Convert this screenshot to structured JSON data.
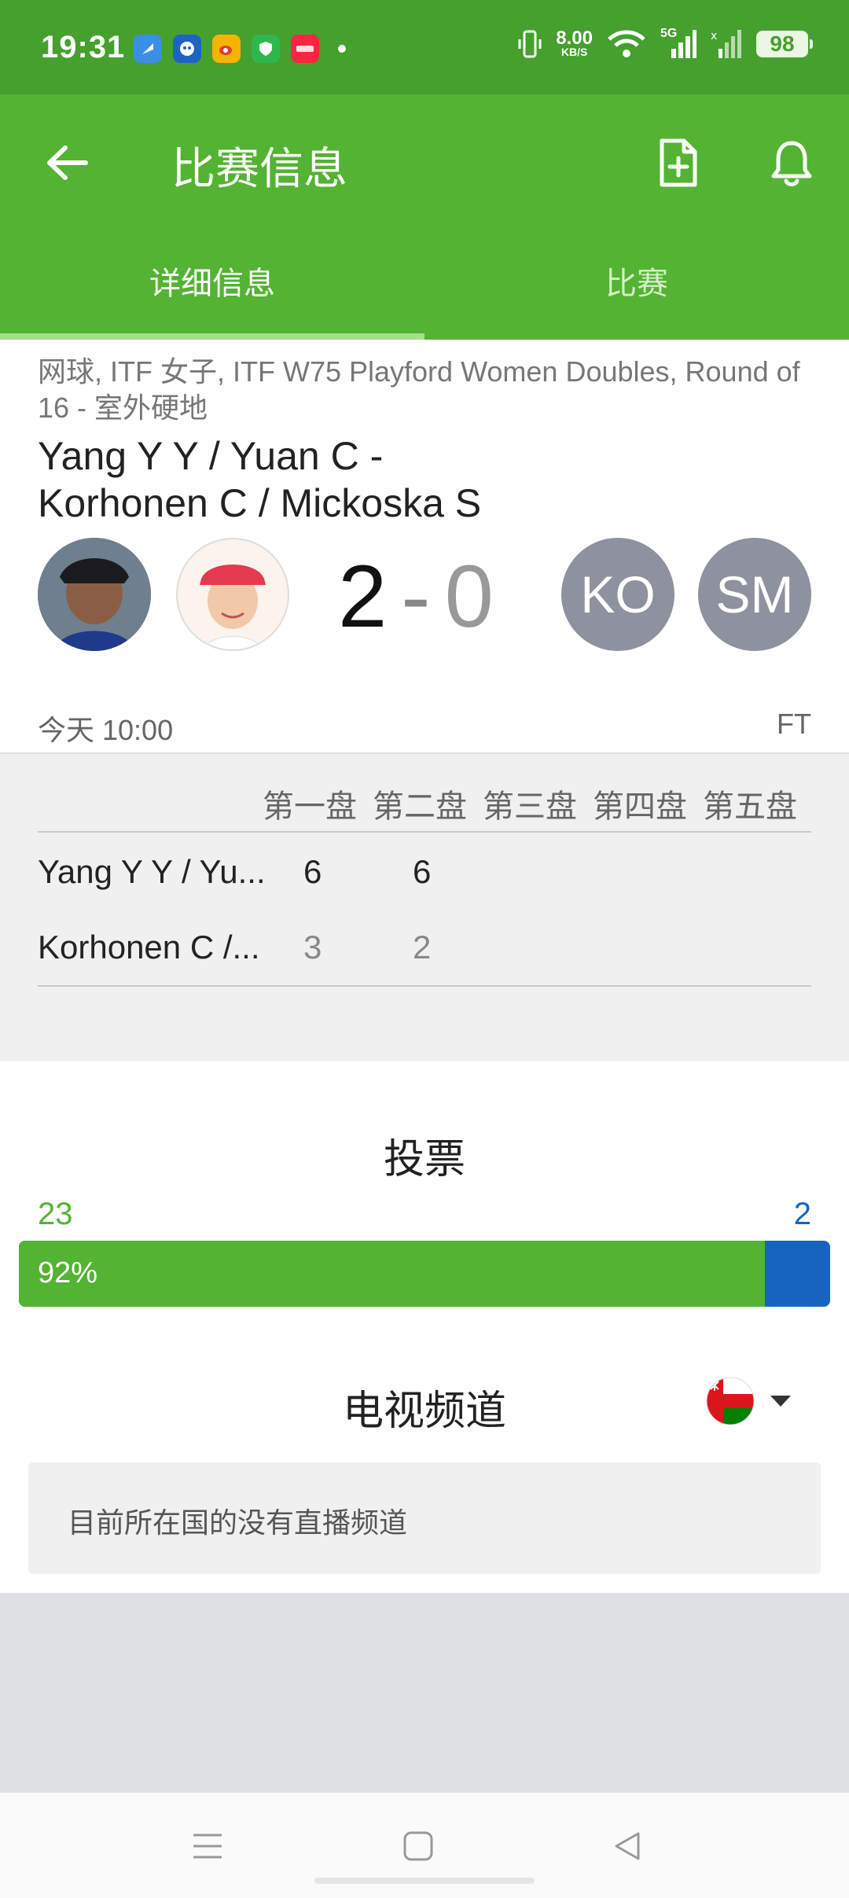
{
  "status_bar": {
    "time": "19:31",
    "speed_value": "8.00",
    "speed_unit": "KB/S",
    "signal": "5G",
    "battery": "98"
  },
  "app_bar": {
    "title": "比赛信息",
    "back_icon": "arrow-left-icon",
    "add_doc_icon": "document-plus-icon",
    "bell_icon": "bell-icon"
  },
  "tabs": [
    {
      "label": "详细信息",
      "active": true
    },
    {
      "label": "比赛",
      "active": false
    }
  ],
  "match": {
    "meta": "网球, ITF 女子, ITF W75 Playford Women Doubles, Round of 16 - 室外硬地",
    "teams_line1": "Yang Y Y / Yuan C -",
    "teams_line2": "Korhonen C / Mickoska S",
    "score_home": "2",
    "score_sep": "-",
    "score_away": "0",
    "away_initials_1": "KO",
    "away_initials_2": "SM",
    "date": "今天 10:00",
    "status": "FT"
  },
  "sets": {
    "headers": [
      "第一盘",
      "第二盘",
      "第三盘",
      "第四盘",
      "第五盘"
    ],
    "rows": [
      {
        "name": "Yang Y Y / Yu...",
        "set1": "6",
        "set2": "6"
      },
      {
        "name": "Korhonen C /...",
        "set1": "3",
        "set2": "2"
      }
    ]
  },
  "vote": {
    "title": "投票",
    "home_count": "23",
    "away_count": "2",
    "home_percent_label": "92%",
    "home_fraction": 0.92,
    "home_color": "#53b332",
    "away_color": "#1565c0"
  },
  "tv": {
    "title": "电视频道",
    "flag_icon": "oman-flag-icon",
    "message": "目前所在国的没有直播频道"
  },
  "colors": {
    "status_bar": "#45a02e",
    "primary": "#53b332"
  }
}
